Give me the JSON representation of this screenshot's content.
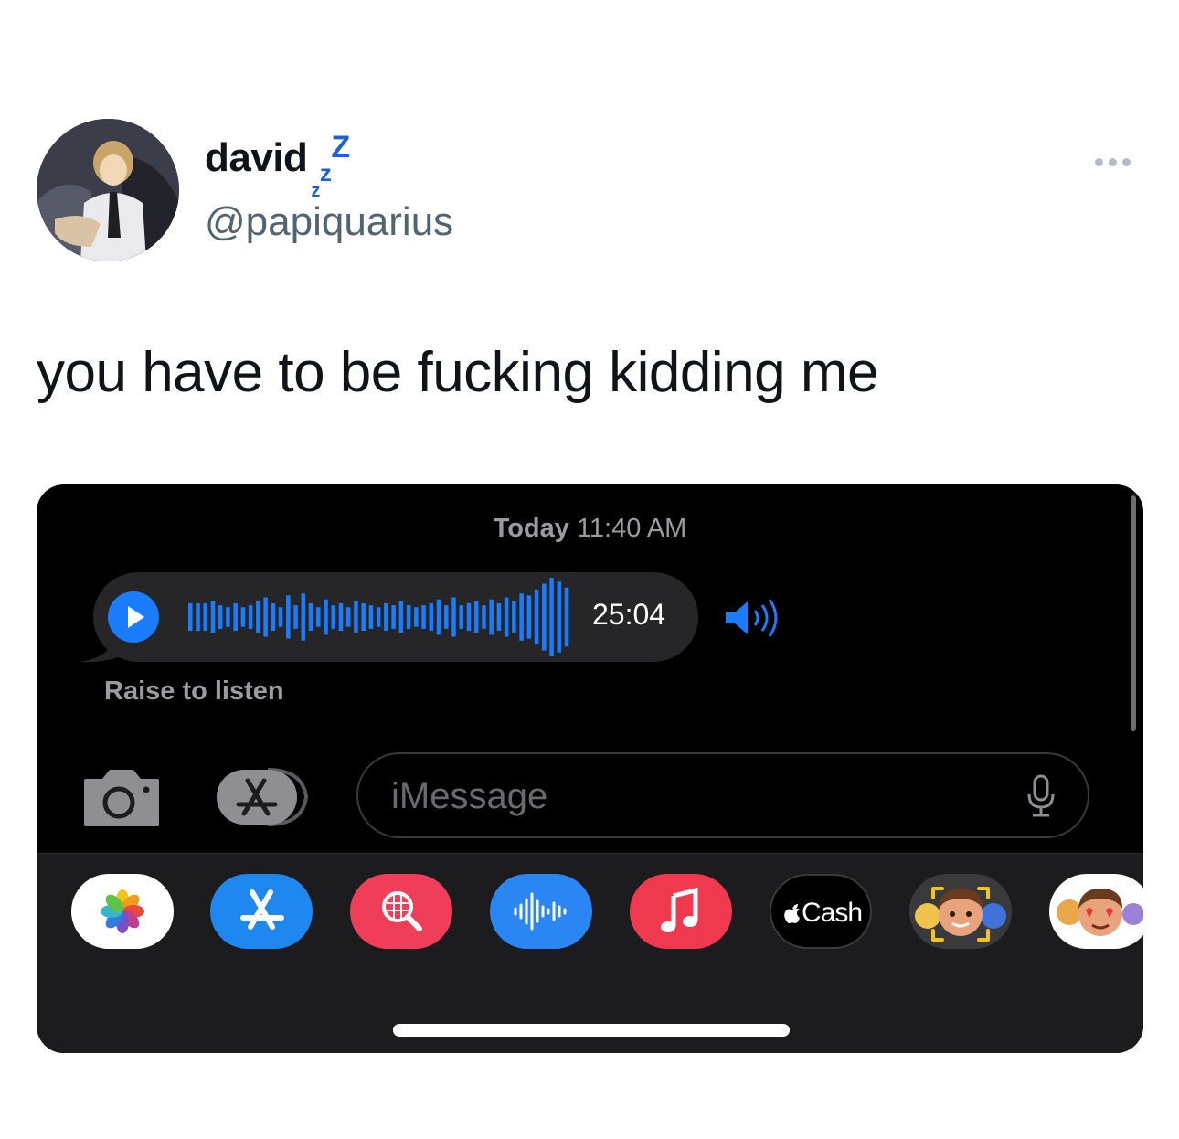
{
  "tweet": {
    "display_name": "david",
    "zzz": [
      "z",
      "z",
      "Z"
    ],
    "handle": "@papiquarius",
    "text": "you have to be fucking kidding me"
  },
  "messages": {
    "timestamp_day": "Today",
    "timestamp_time": "11:40 AM",
    "audio_duration": "25:04",
    "raise_label": "Raise to listen",
    "input_placeholder": "iMessage"
  },
  "app_drawer": {
    "items": [
      "photos-icon",
      "app-store-icon",
      "image-search-icon",
      "audio-message-icon",
      "music-icon",
      "cash",
      "memoji-icon",
      "memoji-stickers-icon"
    ],
    "cash_label": "Cash"
  },
  "colors": {
    "accent_blue": "#1a7cff",
    "screen_bg": "#000000",
    "drawer_bg": "#1c1c1e",
    "bubble_bg": "#262628"
  }
}
